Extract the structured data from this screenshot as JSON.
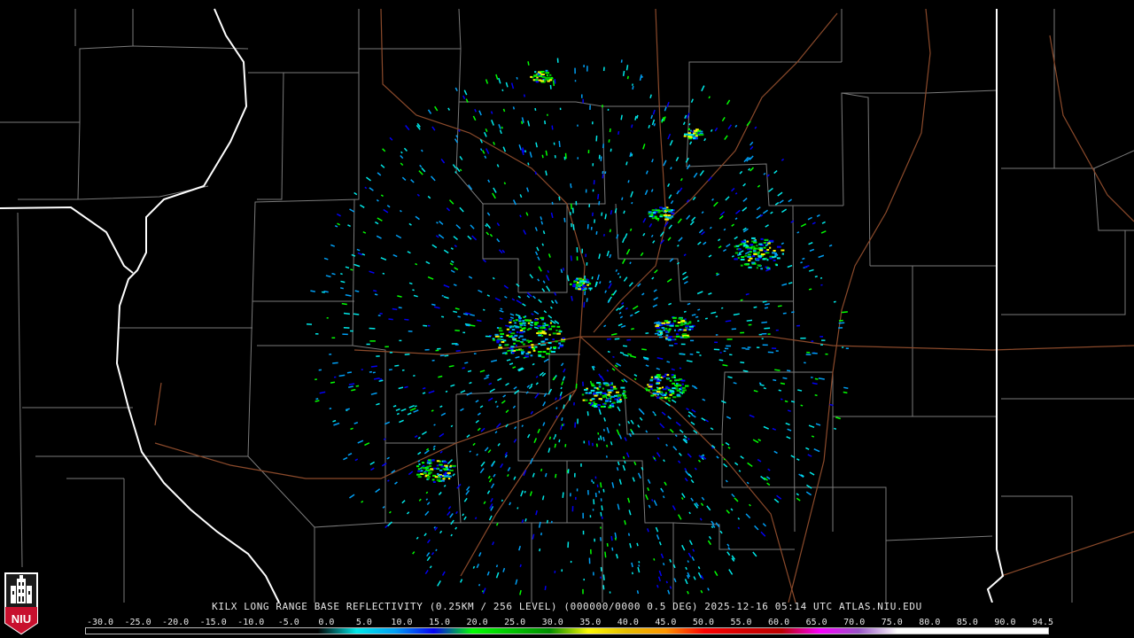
{
  "product": {
    "title": "KILX LONG RANGE BASE REFLECTIVITY (0.25KM / 256 LEVEL) (000000/0000 0.5 DEG) 2025-12-16 05:14 UTC  ATLAS.NIU.EDU"
  },
  "logo": {
    "text": "NIU",
    "color": "#c8102e"
  },
  "legend": {
    "labels": [
      "-30.0",
      "-25.0",
      "-20.0",
      "-15.0",
      "-10.0",
      "-5.0",
      "0.0",
      "5.0",
      "10.0",
      "15.0",
      "20.0",
      "25.0",
      "30.0",
      "35.0",
      "40.0",
      "45.0",
      "50.0",
      "55.0",
      "60.0",
      "65.0",
      "70.0",
      "75.0",
      "80.0",
      "85.0",
      "90.0",
      "94.5"
    ],
    "stops": [
      {
        "dbz": -30,
        "color": "#000000"
      },
      {
        "dbz": 0,
        "color": "#000000"
      },
      {
        "dbz": 5,
        "color": "#00e8e8"
      },
      {
        "dbz": 10,
        "color": "#019ff4"
      },
      {
        "dbz": 15,
        "color": "#0300f4"
      },
      {
        "dbz": 20,
        "color": "#02fd02"
      },
      {
        "dbz": 25,
        "color": "#01c501"
      },
      {
        "dbz": 30,
        "color": "#008e00"
      },
      {
        "dbz": 35,
        "color": "#fdf802"
      },
      {
        "dbz": 40,
        "color": "#e5bc00"
      },
      {
        "dbz": 45,
        "color": "#fd9500"
      },
      {
        "dbz": 50,
        "color": "#fd0000"
      },
      {
        "dbz": 55,
        "color": "#d40000"
      },
      {
        "dbz": 60,
        "color": "#bc0000"
      },
      {
        "dbz": 65,
        "color": "#f800fd"
      },
      {
        "dbz": 70,
        "color": "#9854c6"
      },
      {
        "dbz": 75,
        "color": "#fdfdfd"
      },
      {
        "dbz": 94.5,
        "color": "#ffffff"
      }
    ]
  },
  "map_colors": {
    "background": "#000000",
    "county_border": "#7a7a7a",
    "state_border": "#ffffff",
    "roads": "#8b4a2b"
  }
}
